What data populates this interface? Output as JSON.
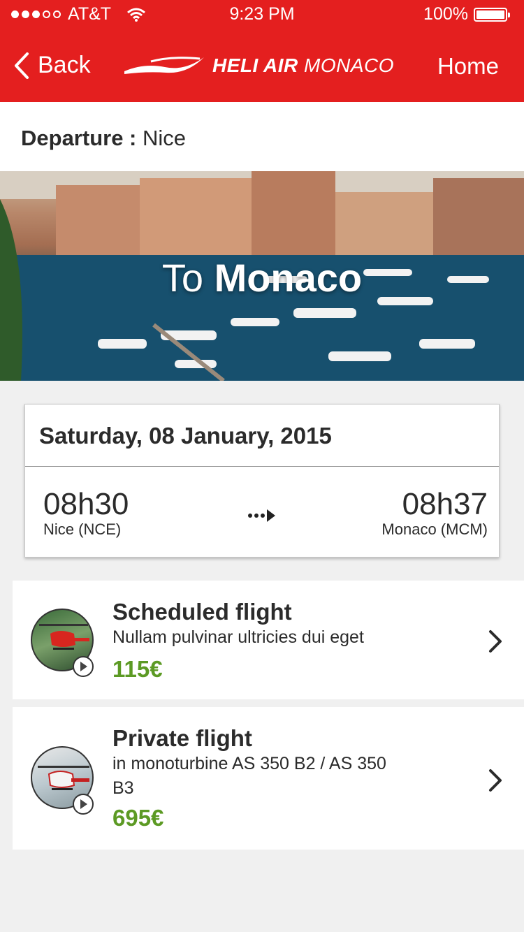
{
  "status_bar": {
    "carrier": "AT&T",
    "time": "9:23 PM",
    "battery": "100%"
  },
  "nav": {
    "back_label": "Back",
    "brand_bold": "HELI AIR",
    "brand_light": "MONACO",
    "home_label": "Home"
  },
  "departure": {
    "label": "Departure :",
    "value": "Nice"
  },
  "hero": {
    "prefix": "To",
    "destination": "Monaco"
  },
  "schedule": {
    "date": "Saturday, 08 January, 2015",
    "departure_time": "08h30",
    "departure_airport": "Nice (NCE)",
    "arrival_time": "08h37",
    "arrival_airport": "Monaco (MCM)"
  },
  "flights": [
    {
      "title": "Scheduled flight",
      "description": "Nullam pulvinar ultricies dui eget",
      "price": "115€"
    },
    {
      "title": "Private flight",
      "description": "in monoturbine AS 350 B2 / AS 350 B3",
      "price": "695€"
    }
  ],
  "colors": {
    "brand_red": "#e41f1f",
    "price_green": "#5c9a24"
  }
}
